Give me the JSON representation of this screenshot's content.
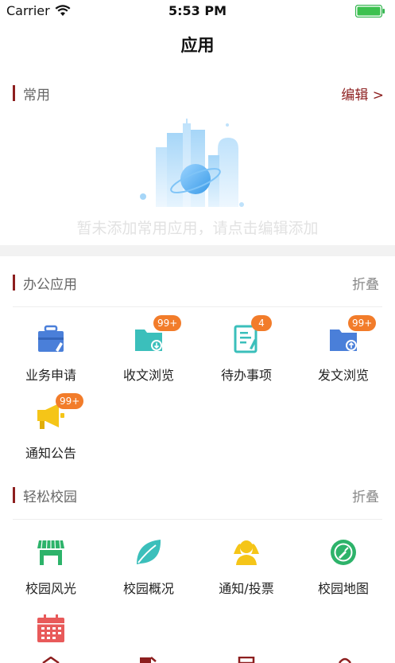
{
  "status_bar": {
    "carrier": "Carrier",
    "time": "5:53 PM"
  },
  "nav": {
    "title": "应用"
  },
  "common": {
    "label": "常用",
    "edit": "编辑 >",
    "empty_text": "暂未添加常用应用，请点击编辑添加"
  },
  "office": {
    "label": "办公应用",
    "fold": "折叠",
    "items": [
      {
        "label": "业务申请",
        "icon": "briefcase-icon",
        "badge": ""
      },
      {
        "label": "收文浏览",
        "icon": "folder-download-icon",
        "badge": "99+"
      },
      {
        "label": "待办事项",
        "icon": "todo-document-icon",
        "badge": "4"
      },
      {
        "label": "发文浏览",
        "icon": "folder-upload-icon",
        "badge": "99+"
      },
      {
        "label": "通知公告",
        "icon": "megaphone-icon",
        "badge": "99+"
      }
    ]
  },
  "campus": {
    "label": "轻松校园",
    "fold": "折叠",
    "items": [
      {
        "label": "校园风光",
        "icon": "storefront-icon"
      },
      {
        "label": "校园概况",
        "icon": "leaf-icon"
      },
      {
        "label": "通知/投票",
        "icon": "vote-hands-icon"
      },
      {
        "label": "校园地图",
        "icon": "map-compass-icon"
      }
    ]
  },
  "colors": {
    "accent": "#8d1f1f",
    "badge": "#f27c2a",
    "blue_icon": "#4a7fd9",
    "teal_icon": "#3bbfbb",
    "yellow_icon": "#f5c518",
    "green_icon": "#2db36a",
    "red_icon": "#e85a5a"
  }
}
